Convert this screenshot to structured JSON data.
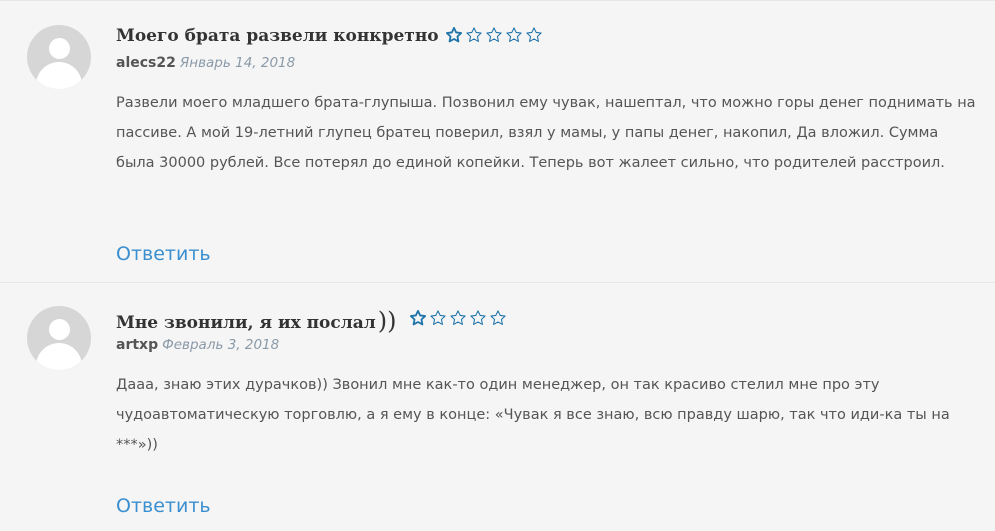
{
  "comments": [
    {
      "title": "Моего брата развели конкретно",
      "rating": 1,
      "author": "alecs22",
      "date": "Январь 14, 2018",
      "text": "Развели моего младшего брата-глупыша. Позвонил ему чувак, нашептал, что можно горы денег поднимать на пассиве. А мой 19-летний глупец братец поверил, взял у мамы, у папы денег, накопил, Да вложил. Сумма была 30000 рублей. Все потерял до единой копейки. Теперь вот жалеет сильно, что родителей расстроил.",
      "reply_label": "Ответить"
    },
    {
      "title": "Мне звонили, я их послал",
      "title_suffix": "))",
      "rating": 1,
      "author": "artxp",
      "date": "Февраль 3, 2018",
      "text": "Дааа, знаю этих дурачков)) Звонил мне как-то один менеджер, он так красиво стелил мне про эту чудоавтоматическую торговлю, а я ему в конце: «Чувак я все знаю, всю правду шарю, так что иди-ка ты на ***»))",
      "reply_label": "Ответить"
    }
  ],
  "colors": {
    "star_filled": "#1e73a8",
    "star_empty": "#1e73a8",
    "reply": "#3a8fd0"
  },
  "icons": {
    "avatar": "default-user-avatar-icon",
    "star": "star-icon"
  }
}
